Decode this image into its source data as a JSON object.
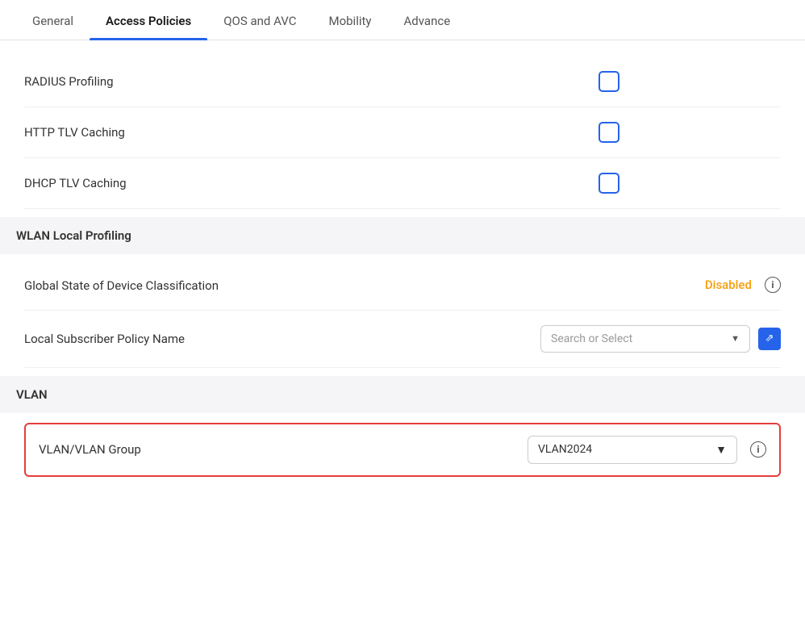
{
  "tabs": [
    {
      "id": "general",
      "label": "General",
      "active": false
    },
    {
      "id": "access-policies",
      "label": "Access Policies",
      "active": true
    },
    {
      "id": "qos-avc",
      "label": "QOS and AVC",
      "active": false
    },
    {
      "id": "mobility",
      "label": "Mobility",
      "active": false
    },
    {
      "id": "advance",
      "label": "Advance",
      "active": false
    }
  ],
  "rows": [
    {
      "id": "radius-profiling",
      "label": "RADIUS Profiling",
      "checked": false
    },
    {
      "id": "http-tlv-caching",
      "label": "HTTP TLV Caching",
      "checked": false
    },
    {
      "id": "dhcp-tlv-caching",
      "label": "DHCP TLV Caching",
      "checked": false
    }
  ],
  "wlan_section": {
    "title": "WLAN Local Profiling"
  },
  "global_state": {
    "label": "Global State of Device Classification",
    "value": "Disabled",
    "info": "i"
  },
  "local_subscriber": {
    "label": "Local Subscriber Policy Name",
    "placeholder": "Search or Select",
    "external_link": "↗"
  },
  "vlan_section": {
    "title": "VLAN"
  },
  "vlan_group": {
    "label": "VLAN/VLAN Group",
    "value": "VLAN2024",
    "info": "i"
  },
  "icons": {
    "chevron_down": "▼",
    "external_link": "⇗",
    "info": "i"
  },
  "colors": {
    "accent_blue": "#2563eb",
    "disabled_orange": "#f59e0b",
    "vlan_border_red": "#e53e3e"
  }
}
